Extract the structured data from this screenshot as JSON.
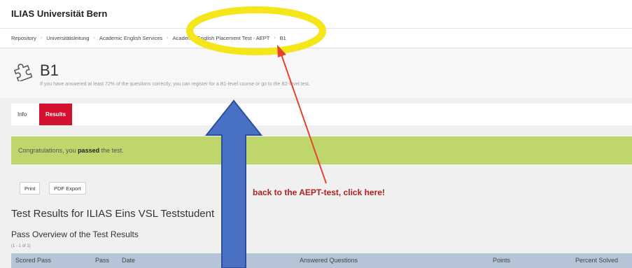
{
  "header": {
    "brand": "ILIAS Universität Bern"
  },
  "breadcrumb": [
    "Repository",
    "Universitätsleitung",
    "Academic English Services",
    "Academic English Placement Test - AEPT",
    "B1"
  ],
  "page": {
    "title": "B1",
    "description": "If you have answered at least 72% of the questions correctly, you can register for a B1-level course or go to the B2-level test.",
    "icon": "puzzle-icon"
  },
  "tabs": [
    {
      "label": "Info",
      "active": false
    },
    {
      "label": "Results",
      "active": true
    }
  ],
  "message": {
    "prefix": "Congratulations, you ",
    "bold": "passed",
    "suffix": " the test."
  },
  "actions": {
    "print": "Print",
    "pdf_export": "PDF Export"
  },
  "results": {
    "heading": "Test Results for ILIAS Eins VSL Teststudent",
    "subheading": "Pass Overview of the Test Results",
    "count": "(1 - 1 of 1)",
    "columns": [
      "Scored Pass",
      "Pass",
      "Date",
      "Answered Questions",
      "Points",
      "Percent Solved"
    ]
  },
  "annotation": {
    "text": "back to the AEPT-test, click here!",
    "highlight_color": "#f5e61b",
    "arrow_color": "#e8412e",
    "big_arrow_color": "#4a72c4"
  },
  "colors": {
    "tab_active": "#d4112e",
    "success_bg": "#bfd66d",
    "table_header": "#b6c4d8"
  }
}
